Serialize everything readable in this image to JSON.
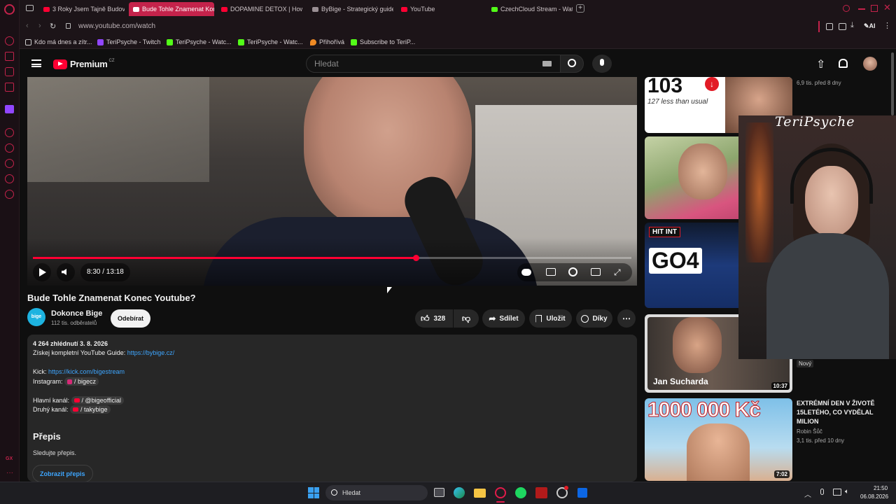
{
  "browser": {
    "tabs": [
      {
        "label": "3 Roky Jsem Tajně Budova",
        "icon": "youtube"
      },
      {
        "label": "Bude Tohle Znamenat Konc",
        "icon": "youtube",
        "active": true
      },
      {
        "label": "DOPAMINE DETOX | How",
        "icon": "youtube"
      },
      {
        "label": "ByBige - Strategický guide",
        "icon": "page"
      },
      {
        "label": "YouTube",
        "icon": "youtube"
      },
      {
        "label": "CzechCloud Stream - Watc",
        "icon": "kick"
      }
    ],
    "url": "www.youtube.com/watch",
    "ai_label": "AI",
    "bookmarks": [
      {
        "label": "Kdo má dnes a zítr...",
        "icon": "page"
      },
      {
        "label": "TeriPsyche - Twitch",
        "icon": "twitch"
      },
      {
        "label": "TeriPsyche - Watc...",
        "icon": "kick"
      },
      {
        "label": "TeriPsyche - Watc...",
        "icon": "kick"
      },
      {
        "label": "Přihořívá",
        "icon": "fire"
      },
      {
        "label": "Subscribe to TeriP...",
        "icon": "kick"
      }
    ]
  },
  "youtube": {
    "logo_text": "Premium",
    "logo_region": "CZ",
    "search_placeholder": "Hledat",
    "player": {
      "time": "8:30 / 13:18",
      "progress": 0.64
    },
    "video_title": "Bude Tohle Znamenat Konec Youtube?",
    "channel": {
      "avatar_text": "bige",
      "name": "Dokonce Bige",
      "subscribers": "112 tis. odběratelů",
      "subscribe_label": "Odebírat"
    },
    "actions": {
      "likes": "328",
      "share": "Sdílet",
      "save": "Uložit",
      "thanks": "Díky"
    },
    "description": {
      "stats": "4 264 zhlédnutí  3. 8. 2026",
      "line1_text": "Získej kompletní YouTube Guide: ",
      "line1_link": "https://bybige.cz/",
      "kick_label": "Kick: ",
      "kick_link": "https://kick.com/bigestream",
      "instagram_label": "Instagram: ",
      "instagram_chip": "/ bigecz",
      "main_channel_label": "Hlavní kanál: ",
      "main_channel_chip": "/ @bigeofficial",
      "second_channel_label": "Druhý kanál: ",
      "second_channel_chip": "/ takybige",
      "transcript_heading": "Přepis",
      "transcript_sub": "Sledujte přepis.",
      "transcript_button": "Zobrazit přepis"
    },
    "sidebar": [
      {
        "thumb_text": "103",
        "thumb_sub": "127 less than usual",
        "meta": "6,9 tis.   před 8 dny"
      },
      {
        "thumb_text": "",
        "meta": ""
      },
      {
        "thumb_text": "GO4",
        "thumb_top": "HIT INT",
        "meta": ""
      },
      {
        "thumb_text": "Jan Sucharda",
        "duration": "10:37",
        "badge": "Nový"
      },
      {
        "thumb_text": "1000 000 Kč",
        "duration": "7:02",
        "title": "EXTRÉMNÍ DEN V ŽIVOTĚ 15LETÉHO, CO VYDĚLAL MILION",
        "channel": "Robin Šůč",
        "meta": "3,1 tis.   před 10 dny"
      }
    ],
    "webcam_name": "TeriPsyche"
  },
  "taskbar": {
    "search_label": "Hledat",
    "time": "21:50",
    "date": "06.08.2026"
  }
}
